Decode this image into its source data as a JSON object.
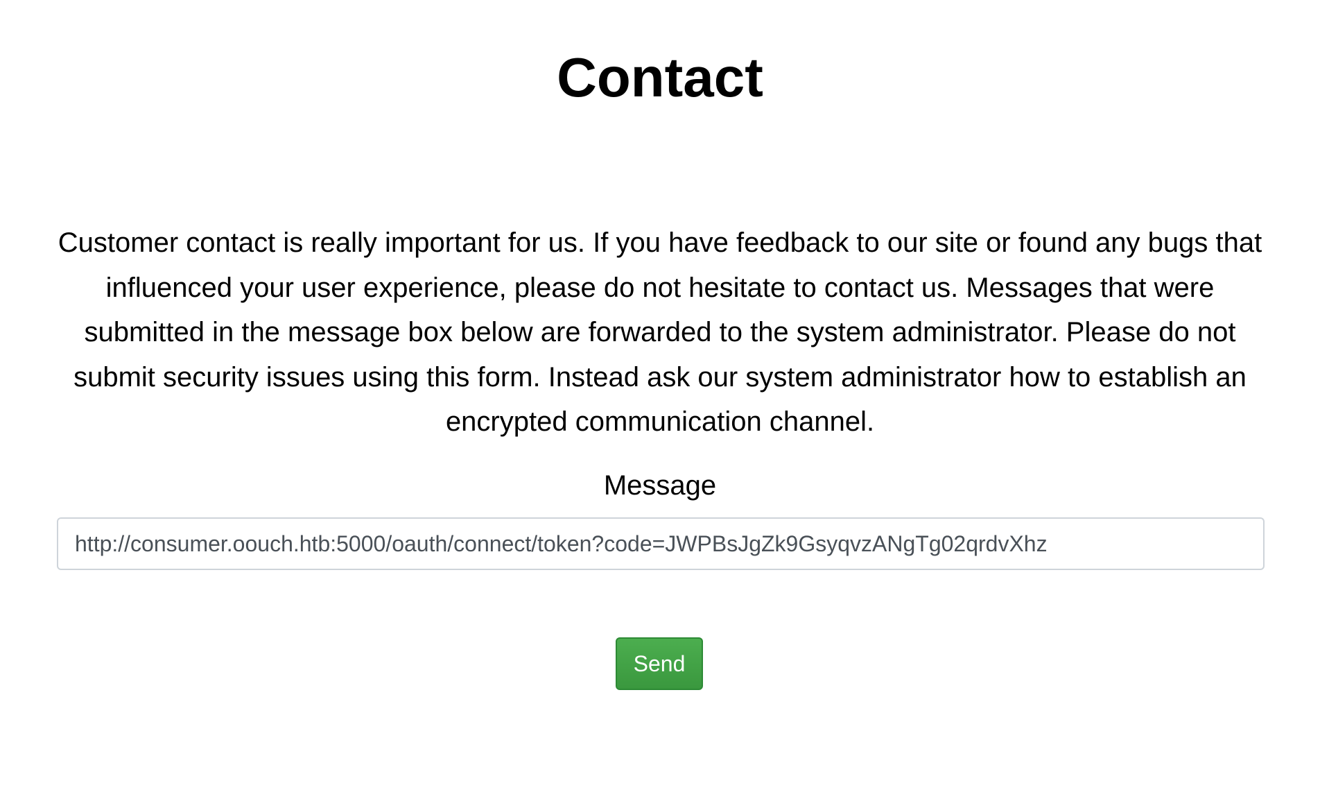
{
  "page": {
    "title": "Contact",
    "description": "Customer contact is really important for us. If you have feedback to our site or found any bugs that influenced your user experience, please do not hesitate to contact us. Messages that were submitted in the message box below are forwarded to the system administrator. Please do not submit security issues using this form. Instead ask our system administrator how to establish an encrypted communication channel."
  },
  "form": {
    "message_label": "Message",
    "message_value": "http://consumer.oouch.htb:5000/oauth/connect/token?code=JWPBsJgZk9GsyqvzANgTg02qrdvXhz",
    "send_label": "Send"
  },
  "colors": {
    "button_green": "#3fa043",
    "input_border": "#ced4da",
    "input_text": "#495057"
  }
}
